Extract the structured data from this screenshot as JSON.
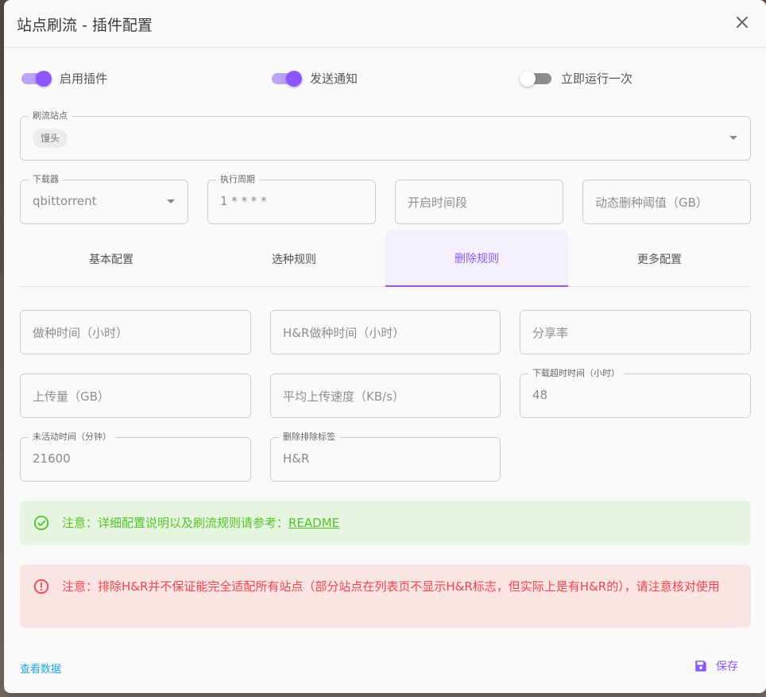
{
  "dialog": {
    "title": "站点刷流 - 插件配置"
  },
  "switches": [
    {
      "label": "启用插件",
      "on": true
    },
    {
      "label": "发送通知",
      "on": true
    },
    {
      "label": "立即运行一次",
      "on": false
    }
  ],
  "site_field": {
    "label": "刷流站点",
    "chip": "馒头"
  },
  "downloader": {
    "label": "下载器",
    "value": "qbittorrent"
  },
  "cron": {
    "label": "执行周期",
    "value": "1 * * * *"
  },
  "time_range": {
    "placeholder": "开启时间段"
  },
  "delete_threshold": {
    "placeholder": "动态删种阈值（GB）"
  },
  "tabs": [
    {
      "label": "基本配置",
      "active": false
    },
    {
      "label": "选种规则",
      "active": false
    },
    {
      "label": "删除规则",
      "active": true
    },
    {
      "label": "更多配置",
      "active": false
    }
  ],
  "rules": {
    "seed_time": {
      "placeholder": "做种时间（小时）"
    },
    "hr_seed_time": {
      "placeholder": "H&R做种时间（小时）"
    },
    "share_ratio": {
      "placeholder": "分享率"
    },
    "upload_size": {
      "placeholder": "上传量（GB）"
    },
    "avg_upload_speed": {
      "placeholder": "平均上传速度（KB/s）"
    },
    "download_timeout": {
      "label": "下载超时时间（小时）",
      "value": "48"
    },
    "inactive_time": {
      "label": "未活动时间（分钟）",
      "value": "21600"
    },
    "exclude_tags": {
      "label": "删除排除标签",
      "value": "H&R"
    }
  },
  "alerts": {
    "info_text": "注意：详细配置说明以及刷流规则请参考：",
    "info_link": "README",
    "warning_text": "注意：排除H&R并不保证能完全适配所有站点（部分站点在列表页不显示H&R标志，但实际上是有H&R的），请注意核对使用"
  },
  "footer": {
    "view_data": "查看数据",
    "save": "保存"
  },
  "colors": {
    "accent": "#8c57ff",
    "success": "#56c22a",
    "error": "#f0454b",
    "link": "#1ea5e0"
  }
}
